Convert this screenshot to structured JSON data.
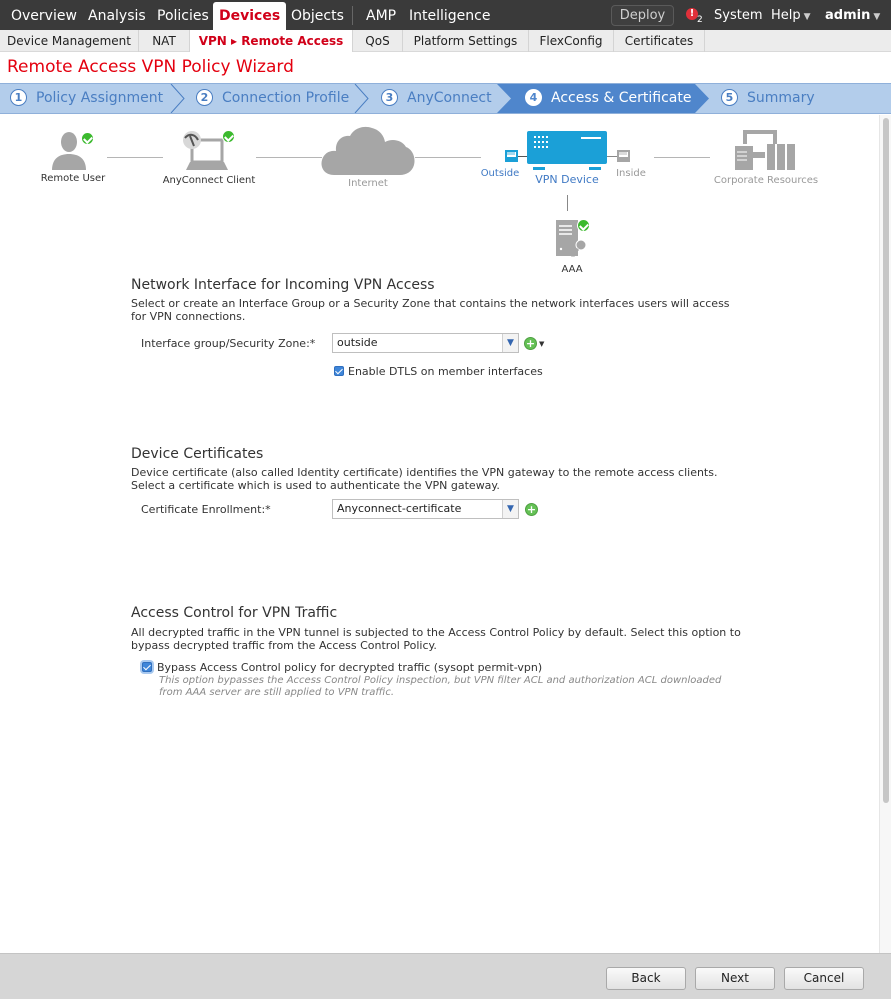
{
  "topnav": {
    "items": [
      {
        "label": "Overview"
      },
      {
        "label": "Analysis"
      },
      {
        "label": "Policies"
      },
      {
        "label": "Devices",
        "active": true
      },
      {
        "label": "Objects"
      },
      {
        "label": "AMP"
      },
      {
        "label": "Intelligence"
      }
    ],
    "deploy_label": "Deploy",
    "alert_icon": "!",
    "alert_count": "2",
    "system_label": "System",
    "help_label": "Help",
    "user_label": "admin",
    "caret": "▼"
  },
  "subnav": {
    "items": [
      {
        "label": "Device Management"
      },
      {
        "label": "NAT"
      },
      {
        "label": "VPN ▸ Remote Access",
        "active": true
      },
      {
        "label": "QoS"
      },
      {
        "label": "Platform Settings"
      },
      {
        "label": "FlexConfig"
      },
      {
        "label": "Certificates"
      }
    ]
  },
  "page_title": "Remote Access VPN Policy Wizard",
  "wizard": {
    "steps": [
      {
        "num": "1",
        "label": "Policy Assignment"
      },
      {
        "num": "2",
        "label": "Connection Profile"
      },
      {
        "num": "3",
        "label": "AnyConnect"
      },
      {
        "num": "4",
        "label": "Access & Certificate",
        "active": true
      },
      {
        "num": "5",
        "label": "Summary"
      }
    ]
  },
  "diagram": {
    "remote_user": "Remote User",
    "anyconnect_client": "AnyConnect Client",
    "internet": "Internet",
    "outside": "Outside",
    "vpn_device": "VPN Device",
    "inside": "Inside",
    "corporate_resources": "Corporate Resources",
    "aaa": "AAA",
    "colors": {
      "active": "#1ba0d7",
      "inactive": "#a6a6a6",
      "check": "#3cba2e"
    }
  },
  "network_interface": {
    "title": "Network Interface for Incoming VPN Access",
    "description": "Select or create an Interface Group or a Security Zone that contains the network interfaces users will access for VPN connections.",
    "field_label": "Interface group/Security Zone:*",
    "value": "outside",
    "dtls_label": "Enable DTLS on member interfaces",
    "dtls_checked": true
  },
  "device_certificates": {
    "title": "Device Certificates",
    "description": "Device certificate (also called Identity certificate) identifies the VPN gateway to the remote access clients. Select a certificate which is used to authenticate the VPN gateway.",
    "field_label": "Certificate Enrollment:*",
    "value": "Anyconnect-certificate"
  },
  "access_control": {
    "title": "Access Control for VPN Traffic",
    "description": "All decrypted traffic in the VPN tunnel is subjected to the Access Control Policy by default. Select this option to bypass decrypted traffic from the Access Control Policy.",
    "bypass_label": "Bypass Access Control policy for decrypted traffic (sysopt permit-vpn)",
    "bypass_checked": true,
    "hint": "This option bypasses the Access Control Policy inspection, but VPN filter ACL and authorization ACL downloaded from AAA server are still applied to VPN traffic."
  },
  "footer": {
    "back_label": "Back",
    "next_label": "Next",
    "cancel_label": "Cancel"
  }
}
